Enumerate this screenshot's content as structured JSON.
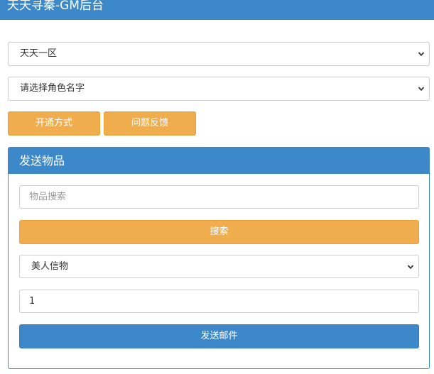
{
  "header": {
    "title": "天天寻秦-GM后台"
  },
  "server_select": {
    "selected": "天天一区"
  },
  "role_select": {
    "selected": "请选择角色名字"
  },
  "buttons": {
    "activate_label": "开通方式",
    "feedback_label": "问题反馈"
  },
  "send_panel": {
    "title": "发送物品",
    "search_placeholder": "物品搜索",
    "search_button_label": "搜索",
    "item_selected": "美人信物",
    "quantity": "1",
    "send_button_label": "发送邮件"
  },
  "colors": {
    "primary_blue": "#3d88c8",
    "accent_orange": "#f0ad4e"
  },
  "icons": {
    "dropdown": "chevron-down-icon"
  }
}
